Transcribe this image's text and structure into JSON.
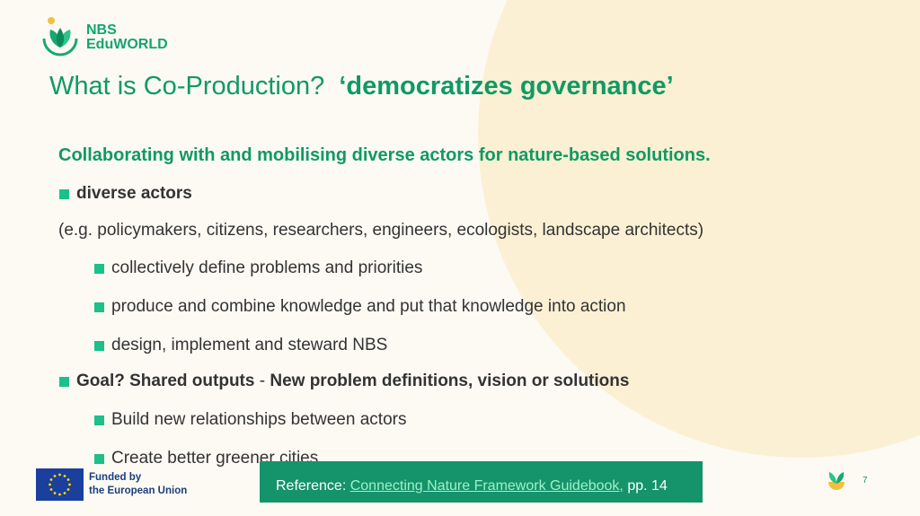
{
  "logo": {
    "line1": "NBS",
    "line2": "EduWORLD"
  },
  "title": {
    "regular": "What is Co-Production?",
    "bold": "‘democratizes governance’"
  },
  "subhead": "Collaborating with and mobilising diverse actors for nature-based solutions.",
  "bullet1": "diverse actors",
  "examples": "(e.g. policymakers, citizens, researchers, engineers, ecologists, landscape architects)",
  "sub_bullets_1": [
    "collectively define problems and priorities",
    "produce and combine knowledge and put that knowledge into action",
    "design, implement and steward NBS"
  ],
  "bullet2": {
    "bold1": "Goal? Shared outputs",
    "sep": " - ",
    "bold2": "New problem definitions, vision or solutions"
  },
  "sub_bullets_2": [
    "Build new relationships between actors",
    "Create better greener cities"
  ],
  "reference": {
    "label": "Reference: ",
    "link": "Connecting Nature Framework Guidebook,",
    "tail": " pp. 14"
  },
  "footer": {
    "eu_line1": "Funded by",
    "eu_line2": "the European Union",
    "page": "7"
  },
  "colors": {
    "accent": "#0f9a63",
    "bullet": "#1bc08a",
    "ref_bg": "#15936b",
    "blob": "#fbf0d4"
  }
}
